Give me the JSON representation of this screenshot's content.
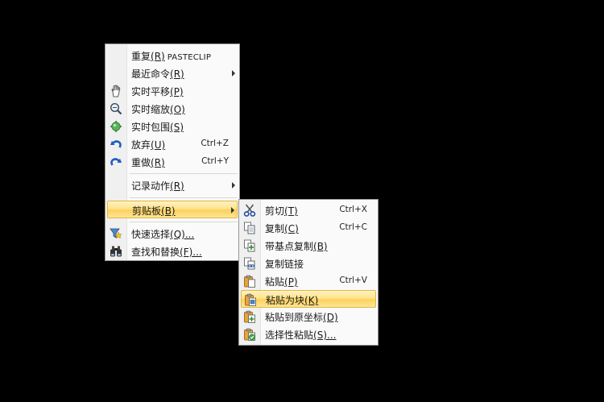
{
  "main_menu": {
    "items": [
      {
        "label": "重复",
        "accel": "(R)",
        "suffix": "PASTECLIP",
        "shortcut": "",
        "submenu": false
      },
      {
        "label": "最近命令",
        "accel": "(R)",
        "suffix": "",
        "shortcut": "",
        "submenu": true
      },
      {
        "label": "实时平移",
        "accel": "(P)",
        "suffix": "",
        "shortcut": "",
        "submenu": false
      },
      {
        "label": "实时缩放",
        "accel": "(O)",
        "suffix": "",
        "shortcut": "",
        "submenu": false
      },
      {
        "label": "实时包围",
        "accel": "(S)",
        "suffix": "",
        "shortcut": "",
        "submenu": false
      },
      {
        "label": "放弃",
        "accel": "(U)",
        "suffix": "",
        "shortcut": "Ctrl+Z",
        "submenu": false
      },
      {
        "label": "重做",
        "accel": "(R)",
        "suffix": "",
        "shortcut": "Ctrl+Y",
        "submenu": false
      },
      {
        "label": "记录动作",
        "accel": "(R)",
        "suffix": "",
        "shortcut": "",
        "submenu": true
      },
      {
        "label": "剪贴板",
        "accel": "(B)",
        "suffix": "",
        "shortcut": "",
        "submenu": true
      },
      {
        "label": "快速选择",
        "accel": "(Q)...",
        "suffix": "",
        "shortcut": "",
        "submenu": false
      },
      {
        "label": "查找和替换",
        "accel": "(F)...",
        "suffix": "",
        "shortcut": "",
        "submenu": false
      }
    ]
  },
  "clipboard_submenu": {
    "items": [
      {
        "label": "剪切",
        "accel": "(T)",
        "shortcut": "Ctrl+X"
      },
      {
        "label": "复制",
        "accel": "(C)",
        "shortcut": "Ctrl+C"
      },
      {
        "label": "带基点复制",
        "accel": "(B)",
        "shortcut": ""
      },
      {
        "label": "复制链接",
        "accel": "",
        "shortcut": ""
      },
      {
        "label": "粘贴",
        "accel": "(P)",
        "shortcut": "Ctrl+V"
      },
      {
        "label": "粘贴为块",
        "accel": "(K)",
        "shortcut": ""
      },
      {
        "label": "粘贴到原坐标",
        "accel": "(D)",
        "shortcut": ""
      },
      {
        "label": "选择性粘贴",
        "accel": "(S)...",
        "shortcut": ""
      }
    ]
  },
  "colors": {
    "highlight": "#fcd25a",
    "highlight_border": "#e5b53c",
    "menu_bg": "#fafafa",
    "gutter_bg": "#f0f0f0",
    "background": "#000000"
  }
}
